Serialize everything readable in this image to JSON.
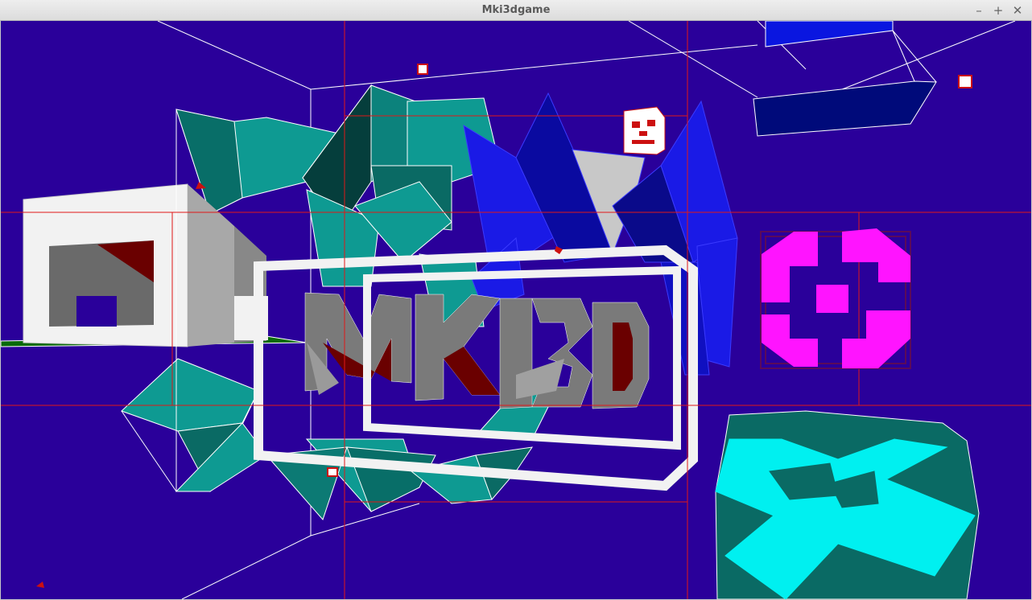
{
  "window": {
    "title": "Mki3dgame",
    "minimize_glyph": "–",
    "maximize_glyph": "+",
    "close_glyph": "✕"
  },
  "scene": {
    "background_color": "#2a009a",
    "grid_line_color": "#e01818",
    "wire_color": "#ffffff",
    "logo_text": "MKI3D",
    "colors": {
      "teal": "#0e9a92",
      "teal_dark": "#0a6a64",
      "blue": "#1a1ae6",
      "navy": "#000a7a",
      "magenta": "#ff14ff",
      "cyan": "#00f0f0",
      "white": "#f2f2f2",
      "grey": "#6e6e6e",
      "dark_red": "#6a0000",
      "green": "#0a6a0a"
    }
  }
}
